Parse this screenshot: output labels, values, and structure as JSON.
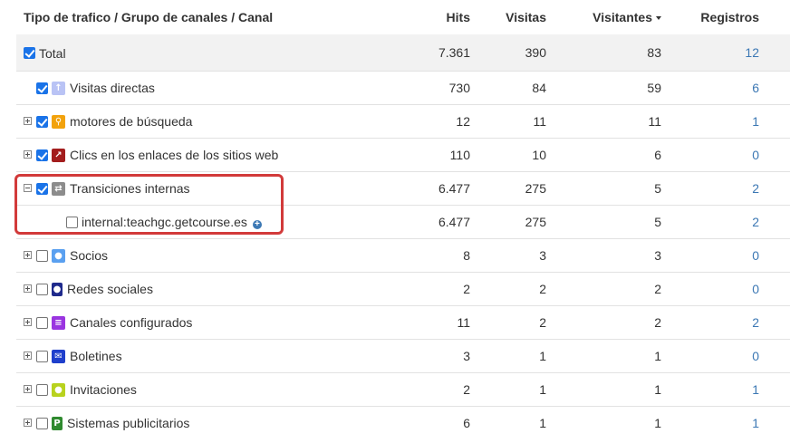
{
  "header": {
    "name": "Tipo de trafico / Grupo de canales / Canal",
    "hits": "Hits",
    "visitas": "Visitas",
    "visitantes": "Visitantes",
    "registros": "Registros"
  },
  "rows": [
    {
      "label": "Total",
      "hits": "7.361",
      "visitas": "390",
      "visitantes": "83",
      "registros": "12"
    },
    {
      "label": "Visitas directas",
      "hits": "730",
      "visitas": "84",
      "visitantes": "59",
      "registros": "6"
    },
    {
      "label": "motores de búsqueda",
      "hits": "12",
      "visitas": "11",
      "visitantes": "11",
      "registros": "1"
    },
    {
      "label": "Clics en los enlaces de los sitios web",
      "hits": "110",
      "visitas": "10",
      "visitantes": "6",
      "registros": "0"
    },
    {
      "label": "Transiciones internas",
      "hits": "6.477",
      "visitas": "275",
      "visitantes": "5",
      "registros": "2"
    },
    {
      "label": "internal:teachgc.getcourse.es",
      "hits": "6.477",
      "visitas": "275",
      "visitantes": "5",
      "registros": "2"
    },
    {
      "label": "Socios",
      "hits": "8",
      "visitas": "3",
      "visitantes": "3",
      "registros": "0"
    },
    {
      "label": "Redes sociales",
      "hits": "2",
      "visitas": "2",
      "visitantes": "2",
      "registros": "0"
    },
    {
      "label": "Canales configurados",
      "hits": "11",
      "visitas": "2",
      "visitantes": "2",
      "registros": "2"
    },
    {
      "label": "Boletines",
      "hits": "3",
      "visitas": "1",
      "visitantes": "1",
      "registros": "0"
    },
    {
      "label": "Invitaciones",
      "hits": "2",
      "visitas": "1",
      "visitantes": "1",
      "registros": "1"
    },
    {
      "label": "Sistemas publicitarios",
      "hits": "6",
      "visitas": "1",
      "visitantes": "1",
      "registros": "1"
    }
  ],
  "icons": {
    "direct": {
      "name": "arrow-up-icon",
      "color": "#b9c3f5"
    },
    "search": {
      "name": "magnifier-icon",
      "color": "#f2a20c"
    },
    "links": {
      "name": "external-link-icon",
      "color": "#a31d1d"
    },
    "internal": {
      "name": "arrows-transfer-icon",
      "color": "#8c8c8c"
    },
    "partners": {
      "name": "speech-bubble-icon",
      "color": "#5aa0f0"
    },
    "social": {
      "name": "person-icon",
      "color": "#1f2a8c"
    },
    "channels": {
      "name": "list-icon",
      "color": "#9a35e0"
    },
    "newsletter": {
      "name": "envelope-icon",
      "color": "#1f3fcc"
    },
    "invitations": {
      "name": "chat-bubble-icon",
      "color": "#b8d21e"
    },
    "ads": {
      "name": "p-badge-icon",
      "color": "#2f8a2f"
    }
  },
  "colors": {
    "link": "#3c78b4",
    "checkbox": "#1a73e8",
    "highlight": "#d23a3a",
    "total_bg": "#f2f2f2"
  }
}
